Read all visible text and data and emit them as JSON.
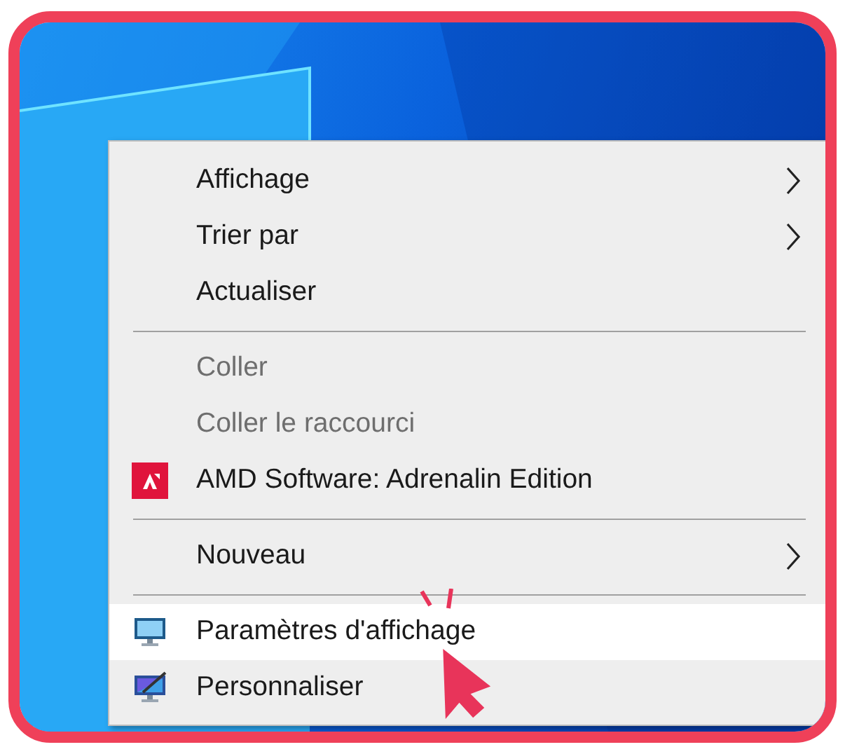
{
  "menu": [
    {
      "kind": "item",
      "label": "Affichage",
      "disabled": false,
      "submenu": true,
      "selected": false
    },
    {
      "kind": "item",
      "label": "Trier par",
      "disabled": false,
      "submenu": true,
      "selected": false
    },
    {
      "kind": "item",
      "label": "Actualiser",
      "disabled": false,
      "submenu": false,
      "selected": false
    },
    {
      "kind": "separator"
    },
    {
      "kind": "item",
      "label": "Coller",
      "disabled": true,
      "submenu": false,
      "selected": false
    },
    {
      "kind": "item",
      "label": "Coller le raccourci",
      "disabled": true,
      "submenu": false,
      "selected": false
    },
    {
      "kind": "app",
      "label": "AMD Software: Adrenalin Edition",
      "disabled": false,
      "submenu": false,
      "selected": false
    },
    {
      "kind": "separator"
    },
    {
      "kind": "item",
      "label": "Nouveau",
      "disabled": false,
      "submenu": true,
      "selected": false
    },
    {
      "kind": "separator"
    },
    {
      "kind": "display",
      "label": "Paramètres d'affichage",
      "disabled": false,
      "submenu": false,
      "selected": true
    },
    {
      "kind": "personalize",
      "label": "Personnaliser",
      "disabled": false,
      "submenu": false,
      "selected": false
    }
  ]
}
